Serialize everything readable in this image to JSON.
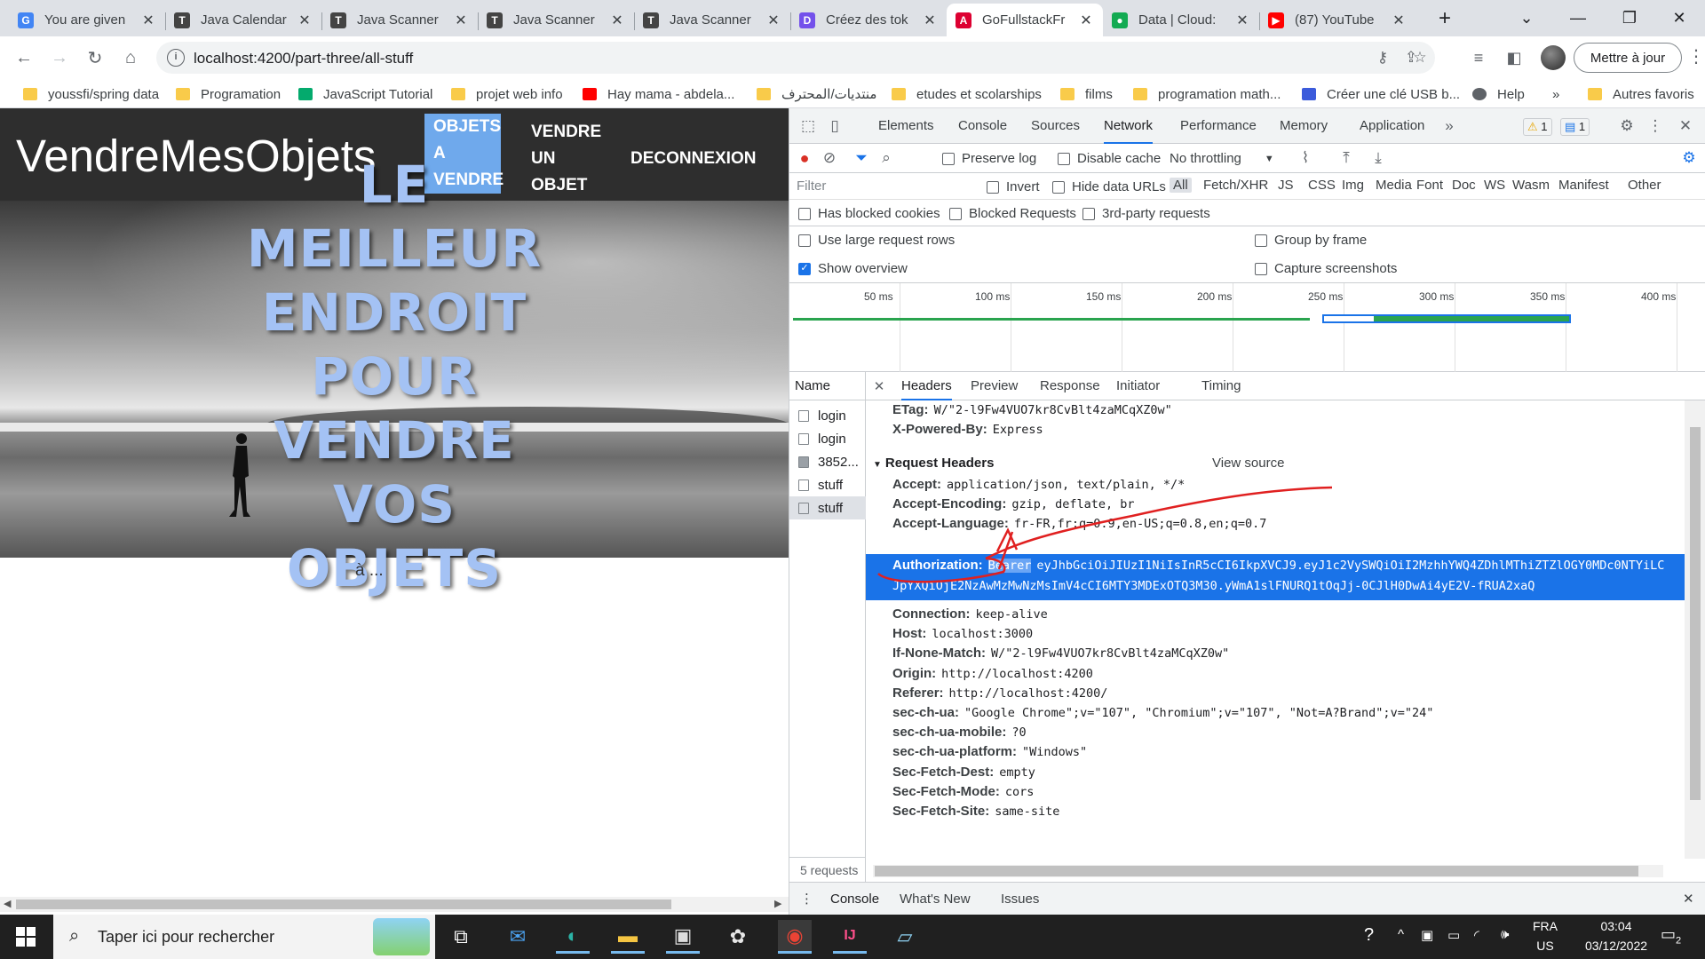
{
  "tabs": [
    {
      "title": "You are given",
      "icon": "google-icon",
      "color": "#4285f4",
      "glyph": "G"
    },
    {
      "title": "Java Calendar",
      "icon": "typora-t-icon",
      "color": "#444",
      "glyph": "T"
    },
    {
      "title": "Java Scanner",
      "icon": "typora-t-icon",
      "color": "#444",
      "glyph": "T"
    },
    {
      "title": "Java Scanner",
      "icon": "typora-t-icon",
      "color": "#444",
      "glyph": "T"
    },
    {
      "title": "Java Scanner",
      "icon": "typora-t-icon",
      "color": "#444",
      "glyph": "T"
    },
    {
      "title": "Créez des tok",
      "icon": "openclassrooms-icon",
      "color": "#7451eb",
      "glyph": "D"
    },
    {
      "title": "GoFullstackFr",
      "icon": "angular-icon",
      "color": "#dd0031",
      "glyph": "A"
    },
    {
      "title": "Data | Cloud:",
      "icon": "mongodb-leaf-icon",
      "color": "#13aa52",
      "glyph": "●"
    },
    {
      "title": "(87) YouTube",
      "icon": "youtube-icon",
      "color": "#ff0000",
      "glyph": "▶"
    }
  ],
  "address": {
    "url": "localhost:4200/part-three/all-stuff"
  },
  "update_button": "Mettre à jour",
  "bookmarks": [
    {
      "label": "youssfi/spring data",
      "icon": "folder-icon"
    },
    {
      "label": "Programation",
      "icon": "folder-icon"
    },
    {
      "label": "JavaScript Tutorial",
      "icon": "w3schools-icon"
    },
    {
      "label": "projet web info",
      "icon": "folder-icon"
    },
    {
      "label": "Hay mama - abdela...",
      "icon": "youtube-icon"
    },
    {
      "label": "منتديات/المحترف",
      "icon": "folder-icon"
    },
    {
      "label": "etudes et scolarships",
      "icon": "folder-icon"
    },
    {
      "label": "films",
      "icon": "folder-icon"
    },
    {
      "label": "programation math...",
      "icon": "folder-icon"
    },
    {
      "label": "Créer une clé USB b...",
      "icon": "usb-tool-icon"
    },
    {
      "label": "Help",
      "icon": "globe-icon"
    },
    {
      "label": "»",
      "icon": ""
    },
    {
      "label": "Autres favoris",
      "icon": "folder-icon"
    }
  ],
  "app": {
    "brand": "VendreMesObjets",
    "nav": {
      "objets": [
        "OBJETS",
        "A",
        "VENDRE"
      ],
      "vendre": [
        "VENDRE",
        "UN",
        "OBJET"
      ],
      "logout": "DECONNEXION"
    },
    "headline": [
      "LE",
      "MEILLEUR",
      "ENDROIT",
      "POUR",
      "VENDRE",
      "VOS",
      "OBJETS"
    ],
    "subtext": "à ..."
  },
  "devtools": {
    "tabs": [
      "Elements",
      "Console",
      "Sources",
      "Network",
      "Performance",
      "Memory",
      "Application"
    ],
    "active_tab": "Network",
    "warnings": "1",
    "messages": "1",
    "toolbar": {
      "preserve_log": "Preserve log",
      "disable_cache": "Disable cache",
      "throttling": "No throttling"
    },
    "filter": {
      "placeholder": "Filter",
      "invert": "Invert",
      "hide_data_urls": "Hide data URLs",
      "types": [
        "All",
        "Fetch/XHR",
        "JS",
        "CSS",
        "Img",
        "Media",
        "Font",
        "Doc",
        "WS",
        "Wasm",
        "Manifest",
        "Other"
      ],
      "blocked_cookies": "Has blocked cookies",
      "blocked_requests": "Blocked Requests",
      "third_party": "3rd-party requests"
    },
    "options": {
      "large_rows": "Use large request rows",
      "group_by_frame": "Group by frame",
      "show_overview": "Show overview",
      "capture_screenshots": "Capture screenshots"
    },
    "timeline_ticks": [
      "50 ms",
      "100 ms",
      "150 ms",
      "200 ms",
      "250 ms",
      "300 ms",
      "350 ms",
      "400 ms"
    ],
    "name_header": "Name",
    "requests": [
      {
        "name": "login",
        "icon": "document-icon"
      },
      {
        "name": "login",
        "icon": "document-icon"
      },
      {
        "name": "3852...",
        "icon": "image-icon"
      },
      {
        "name": "stuff",
        "icon": "document-icon"
      },
      {
        "name": "stuff",
        "icon": "document-icon"
      }
    ],
    "request_count": "5 requests",
    "detail_tabs": [
      "Headers",
      "Preview",
      "Response",
      "Initiator",
      "Timing"
    ],
    "headers_top": [
      {
        "k": "ETag:",
        "v": "W/\"2-l9Fw4VUO7kr8CvBlt4zaMCqXZ0w\""
      },
      {
        "k": "X-Powered-By:",
        "v": "Express"
      }
    ],
    "section_title": "Request Headers",
    "view_source": "View source",
    "request_headers": [
      {
        "k": "Accept:",
        "v": "application/json, text/plain, */*"
      },
      {
        "k": "Accept-Encoding:",
        "v": "gzip, deflate, br"
      },
      {
        "k": "Accept-Language:",
        "v": "fr-FR,fr;q=0.9,en-US;q=0.8,en;q=0.7"
      }
    ],
    "authorization": {
      "k": "Authorization:",
      "bearer": "Bearer",
      "line1": "eyJhbGciOiJIUzI1NiIsInR5cCI6IkpXVCJ9.eyJ1c2VySWQiOiI2MzhhYWQ4ZDhlMThiZTZlOGY0MDc0NTYiLC",
      "line2": "JpYXQiOjE2NzAwMzMwNzMsImV4cCI6MTY3MDExOTQ3M30.yWmA1slFNURQ1tOqJj-0CJlH0DwAi4yE2V-fRUA2xaQ"
    },
    "request_headers_after": [
      {
        "k": "Connection:",
        "v": "keep-alive"
      },
      {
        "k": "Host:",
        "v": "localhost:3000"
      },
      {
        "k": "If-None-Match:",
        "v": "W/\"2-l9Fw4VUO7kr8CvBlt4zaMCqXZ0w\""
      },
      {
        "k": "Origin:",
        "v": "http://localhost:4200"
      },
      {
        "k": "Referer:",
        "v": "http://localhost:4200/"
      },
      {
        "k": "sec-ch-ua:",
        "v": "\"Google Chrome\";v=\"107\", \"Chromium\";v=\"107\", \"Not=A?Brand\";v=\"24\""
      },
      {
        "k": "sec-ch-ua-mobile:",
        "v": "?0"
      },
      {
        "k": "sec-ch-ua-platform:",
        "v": "\"Windows\""
      },
      {
        "k": "Sec-Fetch-Dest:",
        "v": "empty"
      },
      {
        "k": "Sec-Fetch-Mode:",
        "v": "cors"
      },
      {
        "k": "Sec-Fetch-Site:",
        "v": "same-site"
      }
    ],
    "drawer_tabs": [
      "Console",
      "What's New",
      "Issues"
    ]
  },
  "taskbar": {
    "search_placeholder": "Taper ici pour rechercher",
    "lang": "FRA",
    "layout": "US",
    "time": "03:04",
    "date": "03/12/2022",
    "notifications": "2",
    "apps": [
      "task-view-icon",
      "mail-icon",
      "edge-icon",
      "file-explorer-icon",
      "terminal-icon",
      "paint-icon",
      "chrome-icon",
      "intellij-icon",
      "notepad-icon"
    ]
  }
}
